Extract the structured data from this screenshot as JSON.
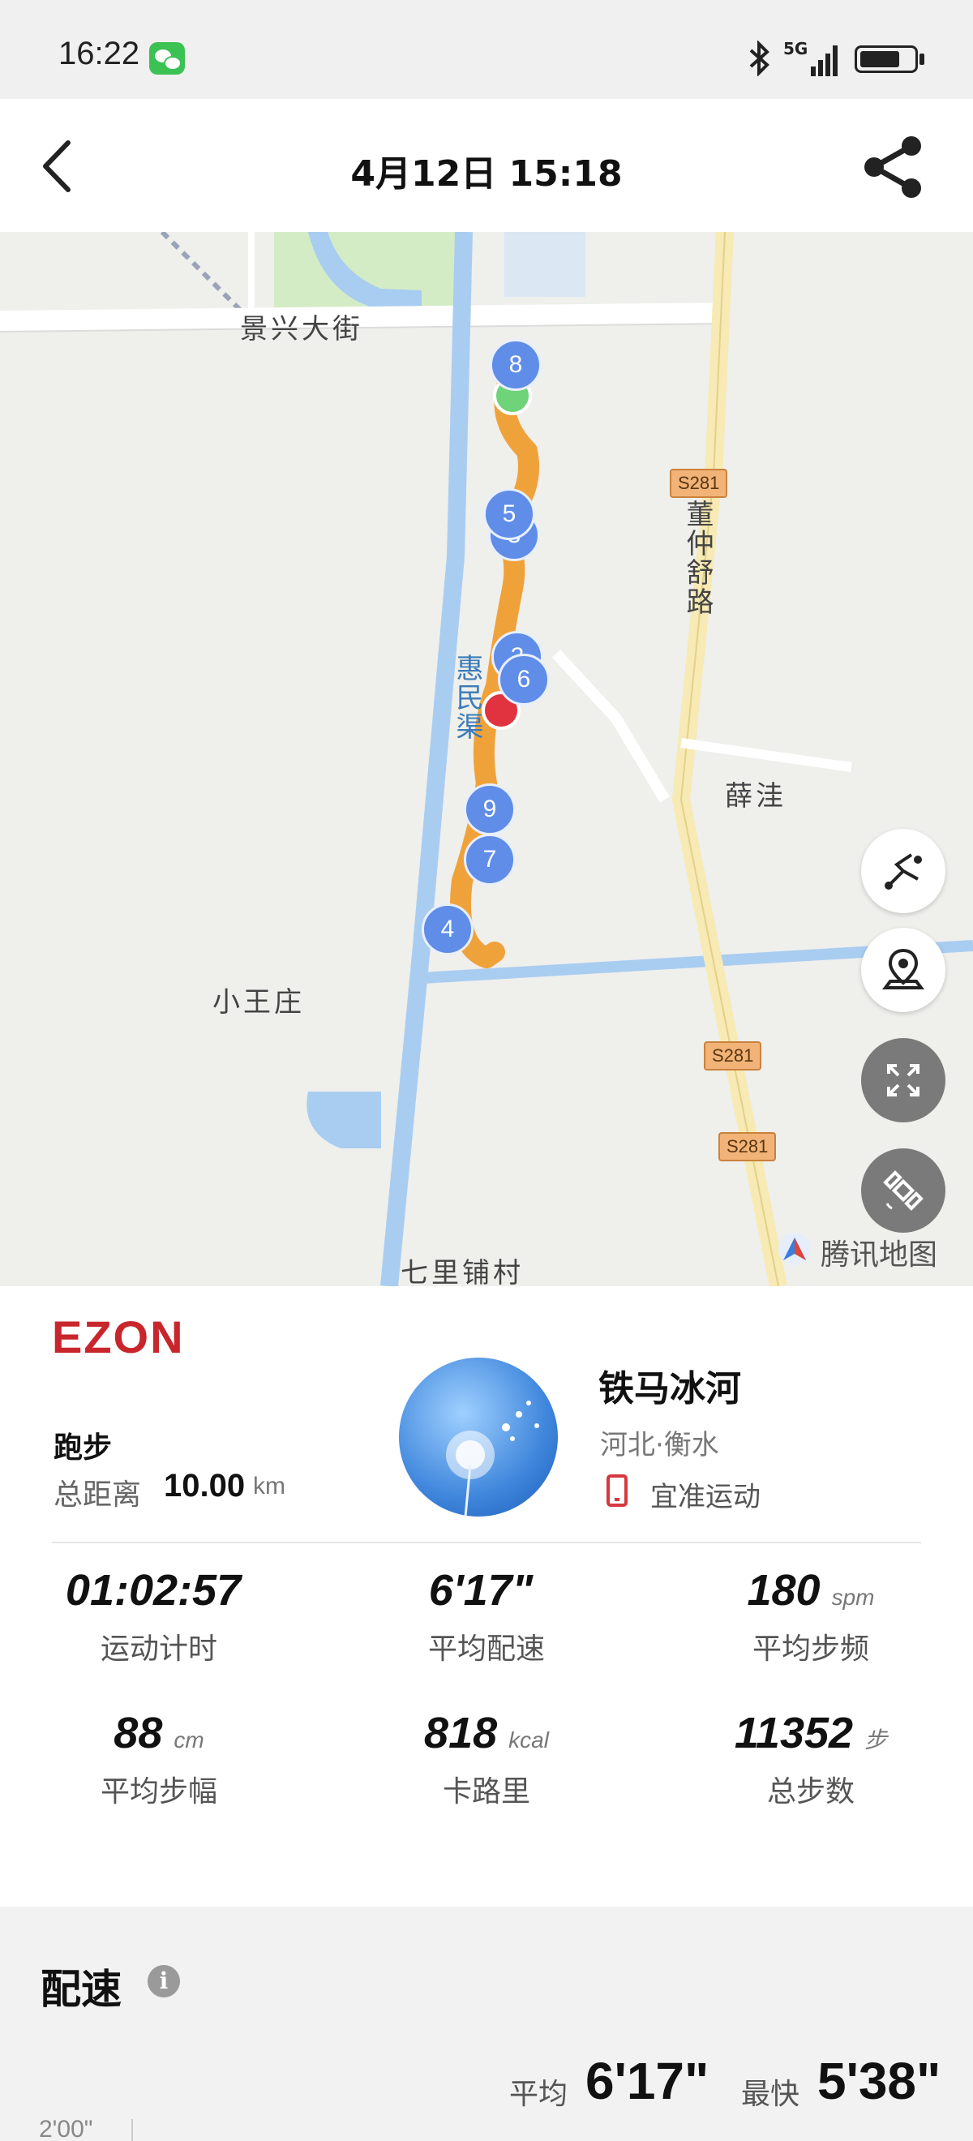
{
  "status_bar": {
    "time": "16:22",
    "network": "5G"
  },
  "header": {
    "title": "4月12日  15:18"
  },
  "map": {
    "labels": {
      "street_jingxing": "景兴大街",
      "road_dongzhongshu": "董仲舒路",
      "canal_huimin": "惠民渠",
      "village_xuewa": "薛洼",
      "village_xiaowangzhuang": "小王庄",
      "village_qilipu": "七里铺村"
    },
    "road_badges": [
      "S281",
      "S281",
      "S281"
    ],
    "km_markers": [
      "8",
      "5",
      "3",
      "2",
      "6",
      "9",
      "7",
      "4"
    ],
    "attribution": "腾讯地图",
    "controls": [
      "route-replay-icon",
      "location-pin-icon",
      "fullscreen-icon",
      "satellite-icon"
    ]
  },
  "summary": {
    "brand": "EZON",
    "sport_type": "跑步",
    "distance_label": "总距离",
    "distance_value": "10.00",
    "distance_unit": "km",
    "user_name": "铁马冰河",
    "user_location": "河北·衡水",
    "device_name": "宜准运动",
    "stats": [
      {
        "value": "01:02:57",
        "unit": "",
        "label": "运动计时"
      },
      {
        "value": "6'17\"",
        "unit": "",
        "label": "平均配速"
      },
      {
        "value": "180",
        "unit": "spm",
        "label": "平均步频"
      },
      {
        "value": "88",
        "unit": "cm",
        "label": "平均步幅"
      },
      {
        "value": "818",
        "unit": "kcal",
        "label": "卡路里"
      },
      {
        "value": "11352",
        "unit": "步",
        "label": "总步数"
      }
    ]
  },
  "pace": {
    "title": "配速",
    "info": "i",
    "avg_label": "平均",
    "avg_value": "6'17\"",
    "best_label": "最快",
    "best_value": "5'38\"",
    "axis_first_tick": "2'00\""
  },
  "colors": {
    "route": "#f0a23a",
    "marker": "#5f8de8",
    "brand": "#c8262c",
    "water": "#a9cdf0"
  }
}
